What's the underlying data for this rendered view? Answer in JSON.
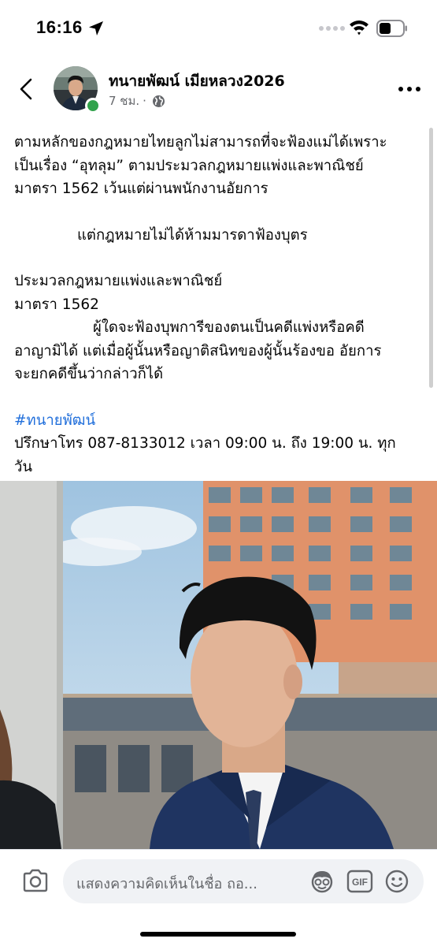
{
  "status_bar": {
    "time": "16:16",
    "icons": [
      "location-arrow-icon",
      "cellular-signal-icon",
      "wifi-icon",
      "battery-icon"
    ]
  },
  "header": {
    "author_name": "ทนายพัฒน์ เมียหลวง2026",
    "time_ago": "7 ชม.",
    "separator": "·",
    "audience_icon": "globe-icon",
    "online_status_color": "#31a24c"
  },
  "post": {
    "lines": [
      "ตามหลักของกฎหมายไทยลูกไม่สามารถที่จะฟ้องแม่ได้เพราะ",
      "เป็นเรื่อง “อุทลุม” ตามประมวลกฎหมายแพ่งและพาณิชย์",
      "มาตรา 1562  เว้นแต่ผ่านพนักงานอัยการ"
    ],
    "centered_line": "แต่กฎหมายไม่ได้ห้ามมารดาฟ้องบุตร",
    "law_title": "ประมวลกฎหมายแพ่งและพาณิชย์",
    "law_section": "มาตรา 1562",
    "law_text_first": "ผู้ใดจะฟ้องบุพการีของตนเป็นคดีแพ่งหรือคดี",
    "law_text_rest": [
      "อาญามิได้ แต่เมื่อผู้นั้นหรือญาติสนิทของผู้นั้นร้องขอ อัยการ",
      "จะยกคดีขึ้นว่ากล่าวก็ได้"
    ],
    "hashtag": "#ทนายพัฒน์",
    "contact_line1": "ปรึกษาโทร 087-8133012 เวลา 09:00 น. ถึง 19:00 น. ทุก",
    "contact_line2": "วัน",
    "hashtag_color": "#216fdb"
  },
  "comment_bar": {
    "placeholder": "แสดงความคิดเห็นในชื่อ ถอ...",
    "icons": [
      "camera-icon",
      "avatar-sticker-icon",
      "gif-icon",
      "emoji-icon"
    ],
    "gif_label": "GIF"
  }
}
